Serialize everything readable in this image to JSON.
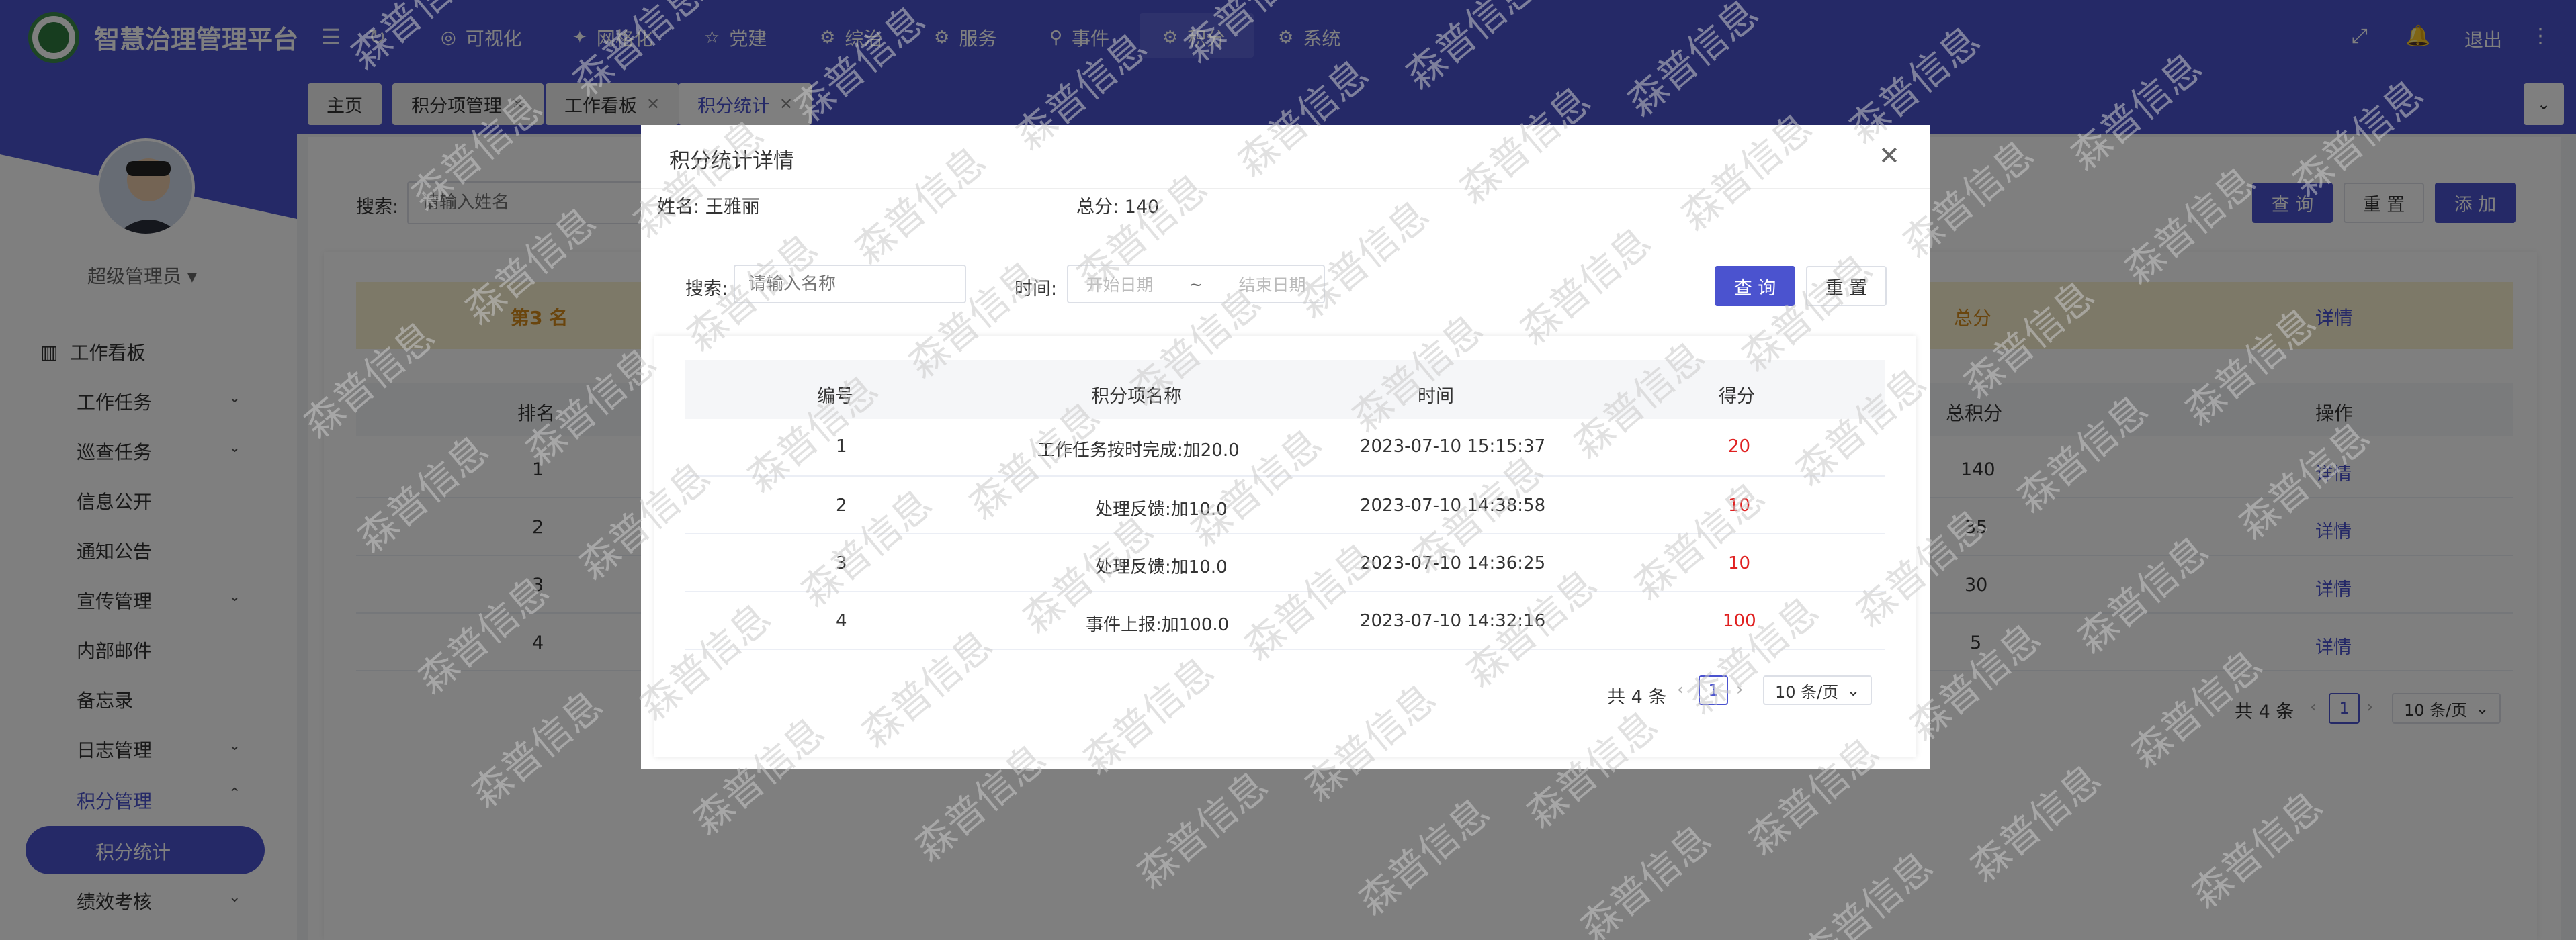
{
  "app": {
    "title": "智慧治理管理平台",
    "logout": "退出"
  },
  "nav": [
    {
      "label": "可视化",
      "icon": "eye-icon"
    },
    {
      "label": "网格化",
      "icon": "grid-icon"
    },
    {
      "label": "党建",
      "icon": "star-icon"
    },
    {
      "label": "综治",
      "icon": "gear-icon"
    },
    {
      "label": "服务",
      "icon": "gear-icon"
    },
    {
      "label": "事件",
      "icon": "pin-icon"
    },
    {
      "label": "积分",
      "icon": "gear-icon"
    },
    {
      "label": "系统",
      "icon": "gear-icon"
    }
  ],
  "user": {
    "role": "超级管理员"
  },
  "sidebar": {
    "items": [
      {
        "label": "工作看板",
        "expand": false
      },
      {
        "label": "工作任务",
        "expand": true
      },
      {
        "label": "巡查任务",
        "expand": true
      },
      {
        "label": "信息公开",
        "expand": false
      },
      {
        "label": "通知公告",
        "expand": false
      },
      {
        "label": "宣传管理",
        "expand": true
      },
      {
        "label": "内部邮件",
        "expand": false
      },
      {
        "label": "备忘录",
        "expand": false
      },
      {
        "label": "日志管理",
        "expand": true
      },
      {
        "label": "积分管理",
        "expand": true,
        "open": true
      },
      {
        "label": "积分统计",
        "active": true
      },
      {
        "label": "绩效考核",
        "expand": true
      }
    ]
  },
  "tabs": [
    {
      "label": "主页",
      "closable": false
    },
    {
      "label": "积分项管理",
      "closable": true
    },
    {
      "label": "工作看板",
      "closable": true
    },
    {
      "label": "积分统计",
      "closable": true,
      "active": true
    }
  ],
  "page": {
    "search_label": "搜索:",
    "search_placeholder": "请输入姓名",
    "query": "查 询",
    "reset": "重 置",
    "add": "添 加",
    "banner_rank": "第3 名",
    "banner_score": "总分",
    "banner_detail": "详情",
    "headers": {
      "rank": "排名",
      "total": "总积分",
      "op": "操作"
    },
    "rows": [
      {
        "rank": "1",
        "total": "140",
        "op": "详情"
      },
      {
        "rank": "2",
        "total": "35",
        "op": "详情"
      },
      {
        "rank": "3",
        "total": "30",
        "op": "详情"
      },
      {
        "rank": "4",
        "total": "5",
        "op": "详情"
      }
    ],
    "pagination": {
      "total": "共 4 条",
      "page": "1",
      "size": "10 条/页"
    }
  },
  "modal": {
    "title": "积分统计详情",
    "name_label": "姓名:",
    "name": "王雅丽",
    "total_label": "总分:",
    "total": "140",
    "search_label": "搜索:",
    "search_placeholder": "请输入名称",
    "time_label": "时间:",
    "start_placeholder": "开始日期",
    "date_sep": "~",
    "end_placeholder": "结束日期",
    "query": "查 询",
    "reset": "重 置",
    "headers": {
      "no": "编号",
      "name": "积分项名称",
      "time": "时间",
      "score": "得分"
    },
    "rows": [
      {
        "no": "1",
        "name": "工作任务按时完成:加20.0",
        "time": "2023-07-10 15:15:37",
        "score": "20"
      },
      {
        "no": "2",
        "name": "处理反馈:加10.0",
        "time": "2023-07-10 14:38:58",
        "score": "10"
      },
      {
        "no": "3",
        "name": "处理反馈:加10.0",
        "time": "2023-07-10 14:36:25",
        "score": "10"
      },
      {
        "no": "4",
        "name": "事件上报:加100.0",
        "time": "2023-07-10 14:32:16",
        "score": "100"
      }
    ],
    "pagination": {
      "total": "共 4 条",
      "page": "1",
      "size": "10 条/页"
    }
  },
  "watermark": "森普信息",
  "colors": {
    "primary": "#4b53cf",
    "score": "#e02020",
    "banner": "#fbf2d0",
    "rank": "#d48a1a"
  }
}
